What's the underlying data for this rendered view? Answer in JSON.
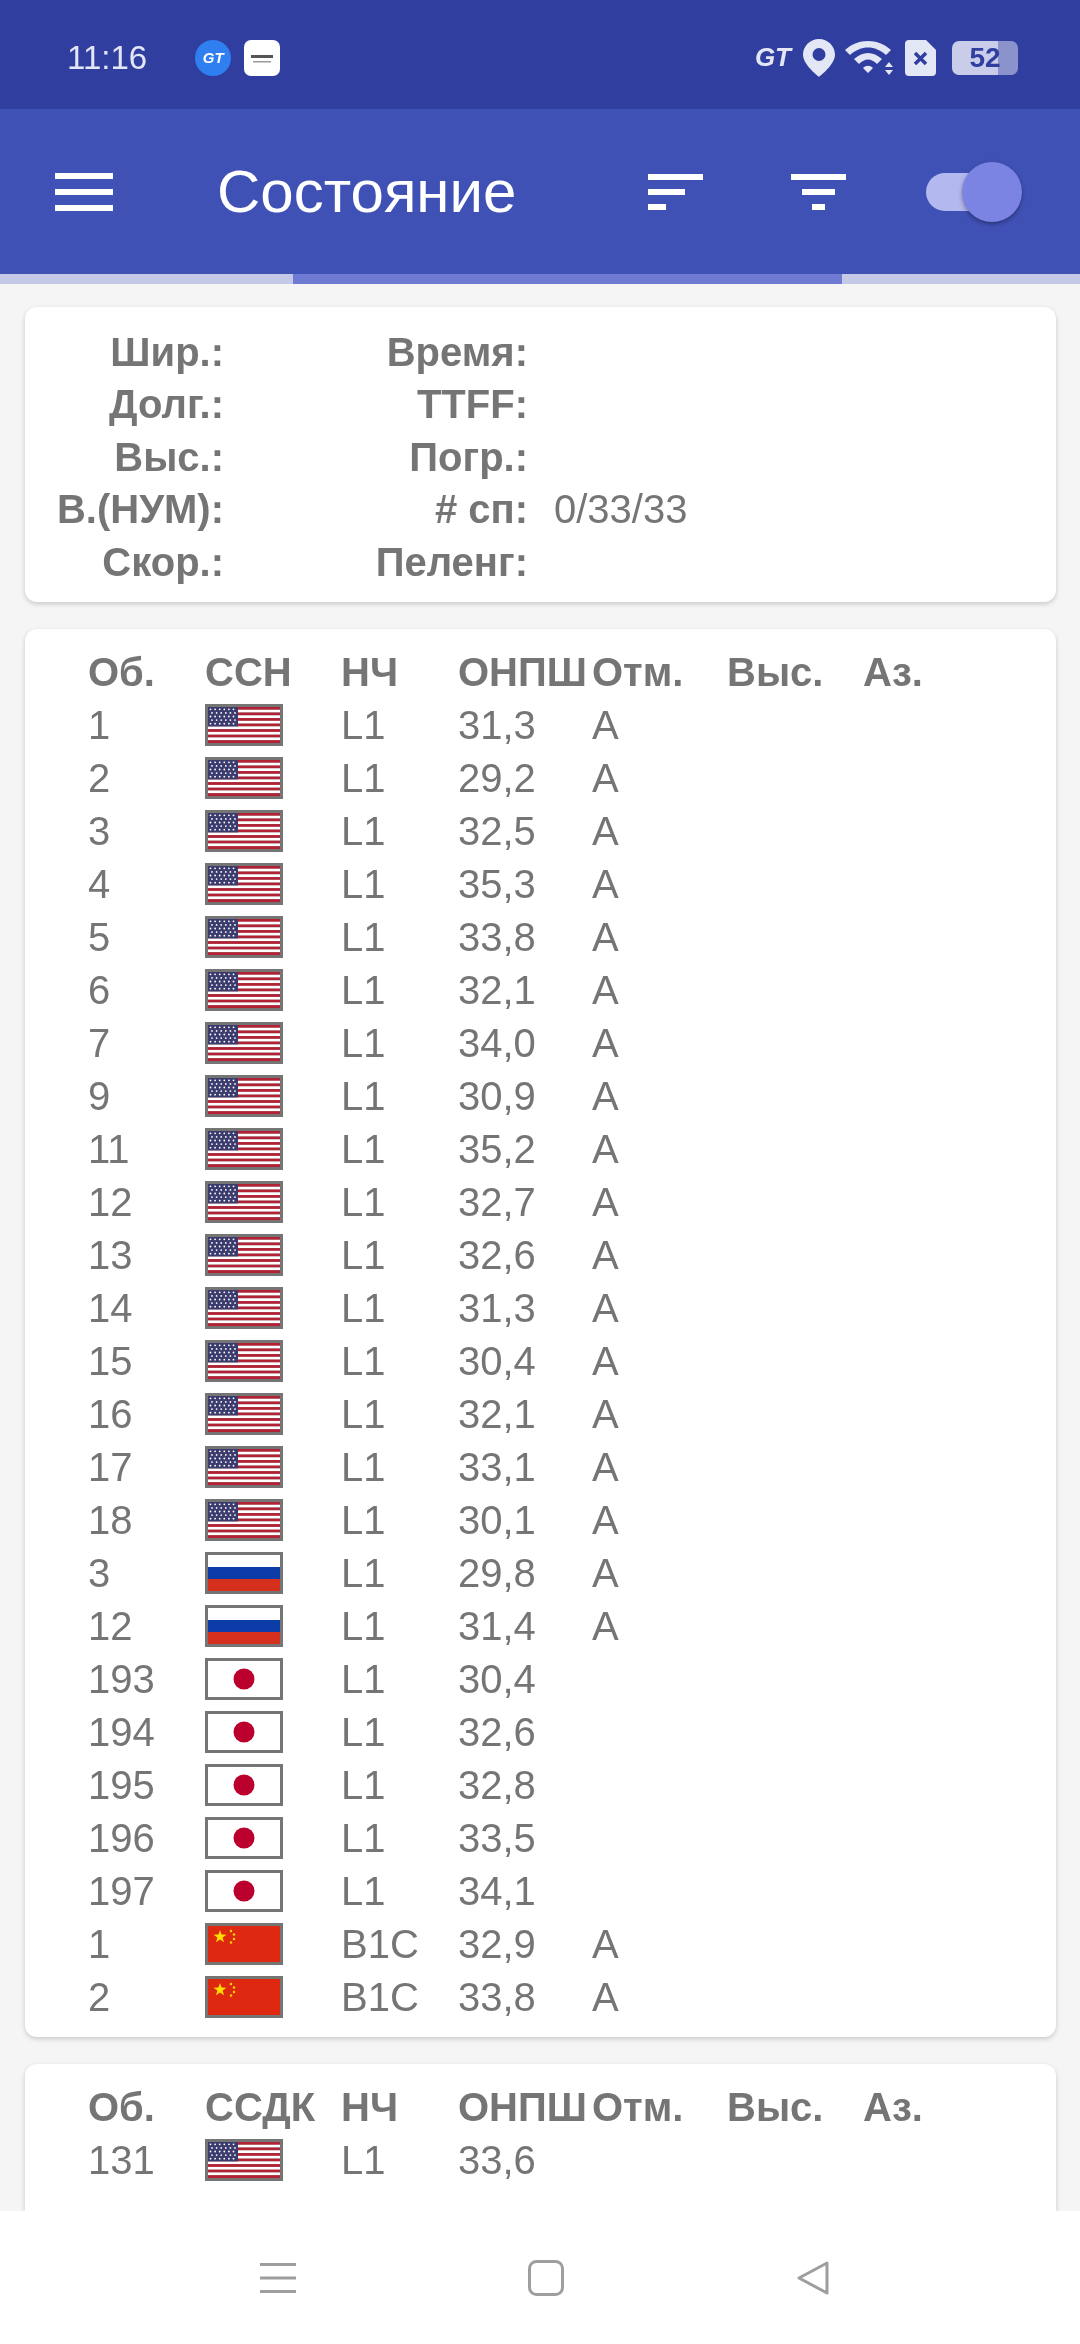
{
  "status_bar": {
    "time": "11:16",
    "notification_badge": "GT",
    "network_label": "GT",
    "battery_text": "52"
  },
  "app_bar": {
    "title": "Состояние",
    "switch_on": true
  },
  "info_panel": {
    "rows": [
      {
        "left": {
          "label": "Шир.:"
        },
        "right": {
          "label": "Время:"
        }
      },
      {
        "left": {
          "label": "Долг.:"
        },
        "right": {
          "label": "TTFF:"
        }
      },
      {
        "left": {
          "label": "Выс.:"
        },
        "right": {
          "label": "Погр.:"
        }
      },
      {
        "left": {
          "label": "В.(НУМ):"
        },
        "right": {
          "label": "# сп:",
          "value": "0/33/33"
        }
      },
      {
        "left": {
          "label": "Скор.:"
        },
        "right": {
          "label": "Пеленг:"
        }
      }
    ]
  },
  "satellite_tables": [
    {
      "columns": [
        "Об.",
        "ССН",
        "НЧ",
        "ОНПШ",
        "Отм.",
        "Выс.",
        "Аз."
      ],
      "rows": [
        {
          "id": "1",
          "kind": "usa",
          "band": "L1",
          "snr": "31,3",
          "mark": "A"
        },
        {
          "id": "2",
          "kind": "usa",
          "band": "L1",
          "snr": "29,2",
          "mark": "A"
        },
        {
          "id": "3",
          "kind": "usa",
          "band": "L1",
          "snr": "32,5",
          "mark": "A"
        },
        {
          "id": "4",
          "kind": "usa",
          "band": "L1",
          "snr": "35,3",
          "mark": "A"
        },
        {
          "id": "5",
          "kind": "usa",
          "band": "L1",
          "snr": "33,8",
          "mark": "A"
        },
        {
          "id": "6",
          "kind": "usa",
          "band": "L1",
          "snr": "32,1",
          "mark": "A"
        },
        {
          "id": "7",
          "kind": "usa",
          "band": "L1",
          "snr": "34,0",
          "mark": "A"
        },
        {
          "id": "9",
          "kind": "usa",
          "band": "L1",
          "snr": "30,9",
          "mark": "A"
        },
        {
          "id": "11",
          "kind": "usa",
          "band": "L1",
          "snr": "35,2",
          "mark": "A"
        },
        {
          "id": "12",
          "kind": "usa",
          "band": "L1",
          "snr": "32,7",
          "mark": "A"
        },
        {
          "id": "13",
          "kind": "usa",
          "band": "L1",
          "snr": "32,6",
          "mark": "A"
        },
        {
          "id": "14",
          "kind": "usa",
          "band": "L1",
          "snr": "31,3",
          "mark": "A"
        },
        {
          "id": "15",
          "kind": "usa",
          "band": "L1",
          "snr": "30,4",
          "mark": "A"
        },
        {
          "id": "16",
          "kind": "usa",
          "band": "L1",
          "snr": "32,1",
          "mark": "A"
        },
        {
          "id": "17",
          "kind": "usa",
          "band": "L1",
          "snr": "33,1",
          "mark": "A"
        },
        {
          "id": "18",
          "kind": "usa",
          "band": "L1",
          "snr": "30,1",
          "mark": "A"
        },
        {
          "id": "3",
          "kind": "russia",
          "band": "L1",
          "snr": "29,8",
          "mark": "A"
        },
        {
          "id": "12",
          "kind": "russia",
          "band": "L1",
          "snr": "31,4",
          "mark": "A"
        },
        {
          "id": "193",
          "kind": "japan",
          "band": "L1",
          "snr": "30,4"
        },
        {
          "id": "194",
          "kind": "japan",
          "band": "L1",
          "snr": "32,6"
        },
        {
          "id": "195",
          "kind": "japan",
          "band": "L1",
          "snr": "32,8"
        },
        {
          "id": "196",
          "kind": "japan",
          "band": "L1",
          "snr": "33,5"
        },
        {
          "id": "197",
          "kind": "japan",
          "band": "L1",
          "snr": "34,1"
        },
        {
          "id": "1",
          "kind": "china",
          "band": "B1C",
          "snr": "32,9",
          "mark": "A"
        },
        {
          "id": "2",
          "kind": "china",
          "band": "B1C",
          "snr": "33,8",
          "mark": "A"
        }
      ]
    },
    {
      "columns": [
        "Об.",
        "ССДК",
        "НЧ",
        "ОНПШ",
        "Отм.",
        "Выс.",
        "Аз."
      ],
      "rows": [
        {
          "id": "131",
          "kind": "usa",
          "band": "L1",
          "snr": "33,6"
        }
      ]
    }
  ]
}
